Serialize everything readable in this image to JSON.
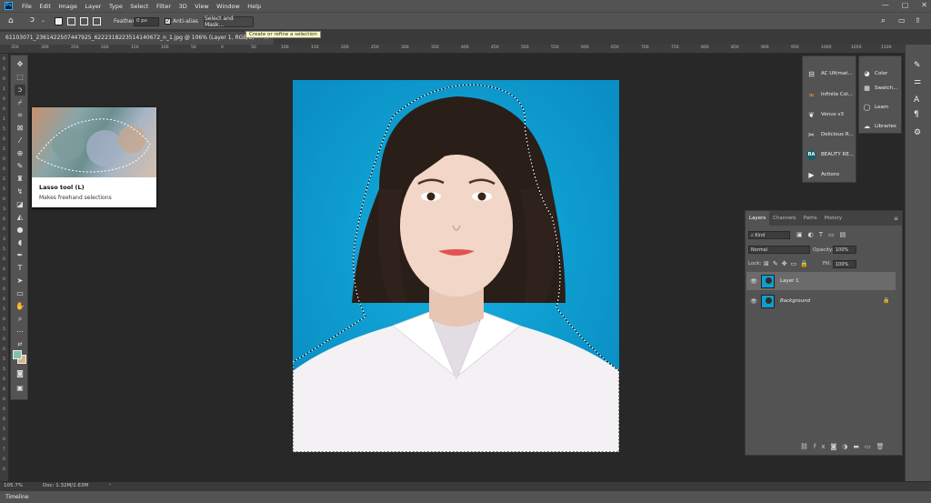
{
  "menu": {
    "app_icon": "Ps",
    "items": [
      "File",
      "Edit",
      "Image",
      "Layer",
      "Type",
      "Select",
      "Filter",
      "3D",
      "View",
      "Window",
      "Help"
    ]
  },
  "window_controls": {
    "minimize": "—",
    "maximize": "▢",
    "close": "✕"
  },
  "options": {
    "feather_label": "Feather:",
    "feather_value": "0 px",
    "antialias_label": "Anti-alias",
    "select_mask_label": "Select and Mask...",
    "tooltip": "Create or refine a selection"
  },
  "document": {
    "tab_title": "61103071_2361422507447925_6222318223514140672_n_1.jpg @ 106% (Layer 1, RGB/8) *",
    "close": "×"
  },
  "ruler": {
    "h_ticks": [
      "350",
      "300",
      "250",
      "200",
      "150",
      "100",
      "50",
      "0",
      "50",
      "100",
      "150",
      "200",
      "250",
      "300",
      "350",
      "400",
      "450",
      "500",
      "550",
      "600",
      "650",
      "700",
      "750",
      "800",
      "850",
      "900",
      "950",
      "1000",
      "1050",
      "1100",
      "1150"
    ],
    "v_ticks": [
      "0",
      "5",
      "0",
      "1",
      "0",
      "0",
      "1",
      "5",
      "0",
      "2",
      "0",
      "0",
      "2",
      "5",
      "0",
      "3",
      "0",
      "0",
      "3",
      "5",
      "0",
      "4",
      "0",
      "0",
      "4",
      "5",
      "0",
      "5",
      "0",
      "0",
      "5",
      "5",
      "0",
      "6",
      "0",
      "0",
      "6",
      "5",
      "0",
      "7",
      "0",
      "0"
    ]
  },
  "tooltip_card": {
    "title": "Lasso tool (L)",
    "description": "Makes freehand selections"
  },
  "plugins": [
    {
      "label": "AC Ultimat...",
      "icon": "ac-ultimate-icon"
    },
    {
      "label": "Infinite Col...",
      "icon": "infinite-color-icon"
    },
    {
      "label": "Venus v3",
      "icon": "venus-icon"
    },
    {
      "label": "Delicious R...",
      "icon": "delicious-retouch-icon"
    },
    {
      "label": "BEAUTY RE...",
      "icon": "beauty-retouch-icon",
      "badge": "RA"
    },
    {
      "label": "Actions",
      "icon": "actions-play-icon"
    }
  ],
  "library_panel": [
    {
      "label": "Color",
      "icon": "color-icon"
    },
    {
      "label": "Swatch...",
      "icon": "swatches-icon"
    },
    {
      "label": "Learn",
      "icon": "learn-icon"
    },
    {
      "label": "Libraries",
      "icon": "libraries-icon"
    }
  ],
  "layers_panel": {
    "tabs": [
      "Layers",
      "Channels",
      "Paths",
      "History"
    ],
    "filter_kind": "Kind",
    "blend_mode": "Normal",
    "opacity_label": "Opacity:",
    "opacity_value": "100%",
    "lock_label": "Lock:",
    "fill_label": "Fill:",
    "fill_value": "100%",
    "layers": [
      {
        "name": "Layer 1",
        "visible": true,
        "selected": true,
        "locked": false
      },
      {
        "name": "Background",
        "visible": true,
        "selected": false,
        "locked": true
      }
    ],
    "footer_icons": [
      "link-icon",
      "fx-icon",
      "mask-icon",
      "adjustment-icon",
      "group-icon",
      "new-layer-icon",
      "delete-icon"
    ]
  },
  "status": {
    "zoom": "105.7%",
    "doc": "Doc: 1.32M/2.63M",
    "arrow": "›"
  },
  "timeline": {
    "label": "Timeline"
  },
  "colors": {
    "accent": "#31a8ff",
    "canvas_bg": "#0e9fd0",
    "foreground": "#7fc3a9",
    "background": "#d7b48e"
  }
}
